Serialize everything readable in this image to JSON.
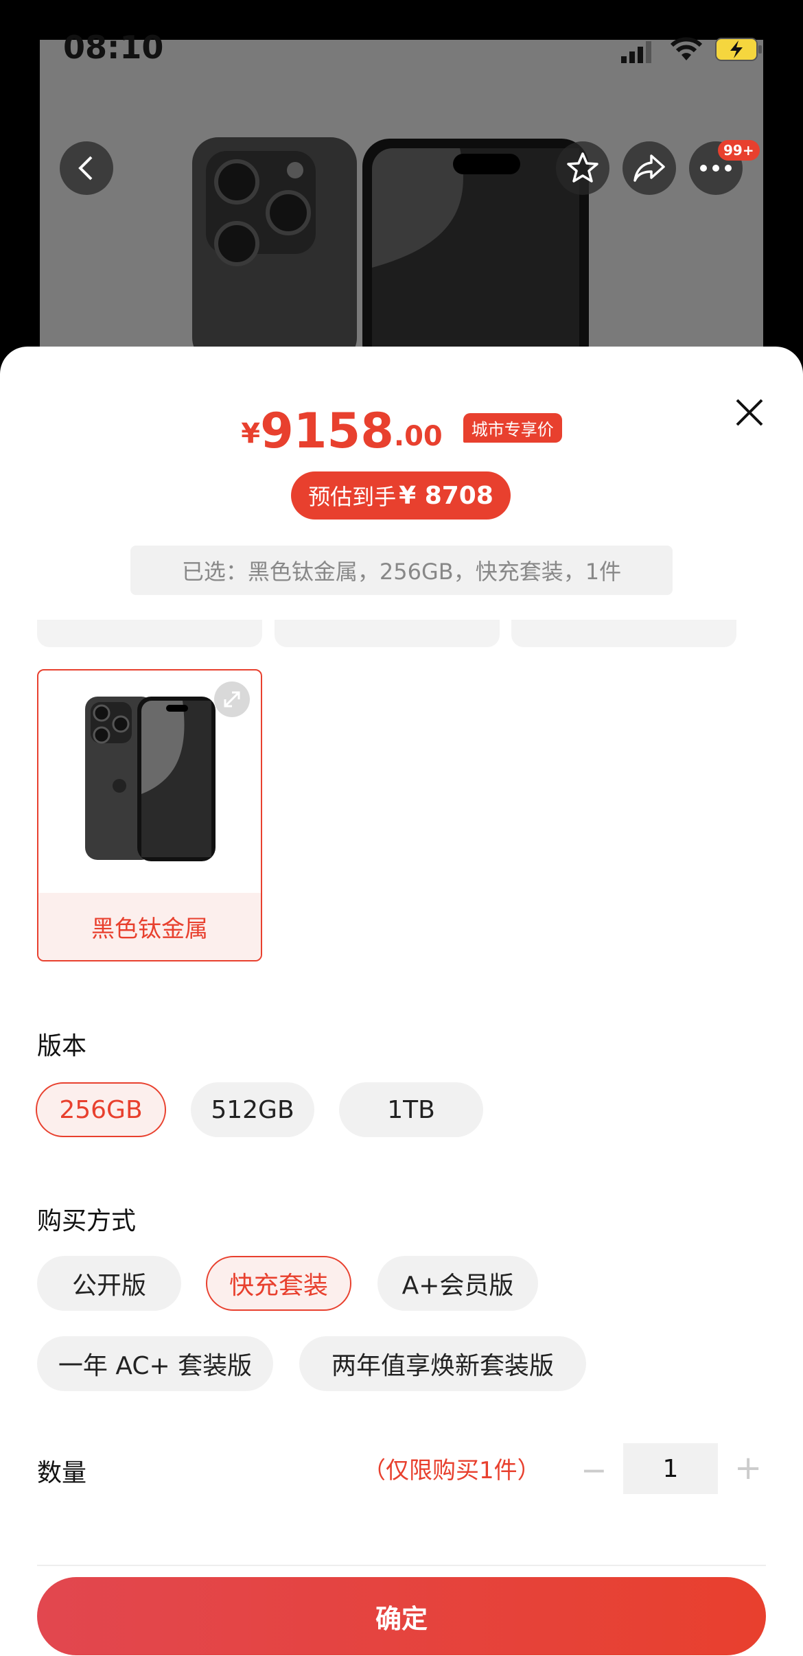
{
  "status_bar": {
    "time": "08:10"
  },
  "header": {
    "badge": "99+"
  },
  "price": {
    "symbol": "¥",
    "integer": "9158",
    "decimal": ".00",
    "tag": "城市专享价",
    "estimate_label": "预估到手",
    "estimate_value": "¥ 8708"
  },
  "selected_summary": "已选：黑色钛金属，256GB，快充套装，1件",
  "color": {
    "selected_label": "黑色钛金属"
  },
  "version": {
    "title": "版本",
    "options": [
      "256GB",
      "512GB",
      "1TB"
    ],
    "selected": "256GB"
  },
  "purchase": {
    "title": "购买方式",
    "options": [
      "公开版",
      "快充套装",
      "A+会员版",
      "一年 AC+ 套装版",
      "两年值享焕新套装版"
    ],
    "selected": "快充套装"
  },
  "quantity": {
    "title": "数量",
    "note": "（仅限购买1件）",
    "minus": "−",
    "value": "1",
    "plus": "+"
  },
  "confirm_label": "确定",
  "colors": {
    "accent": "#e8402e",
    "chip_bg": "#f1f1f1"
  }
}
